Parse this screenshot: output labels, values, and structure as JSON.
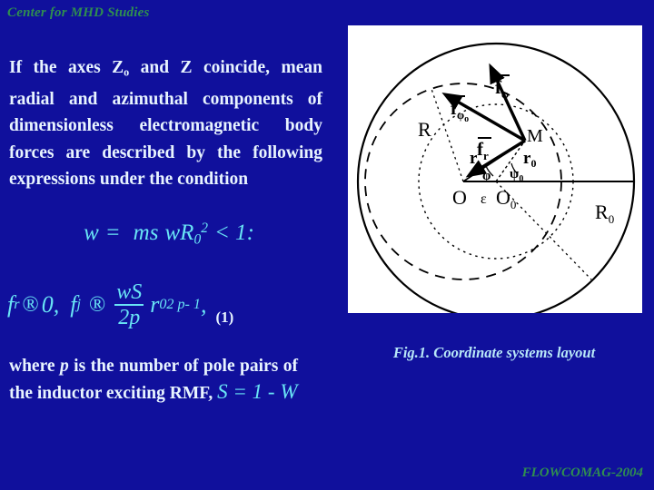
{
  "slide": {
    "background_color": "#10109c",
    "header_color": "#2f8f4f",
    "body_text_color": "#e8f4ff",
    "math_color": "#69e4f5",
    "caption_color": "#b8e8f8"
  },
  "header": {
    "title": "Center for MHD Studies"
  },
  "paragraphs": {
    "intro_part1": "If  the axes Z",
    "intro_sub": "o",
    "intro_part2": "  and Z coincide, mean  radial  and  azimuthal components  of  dimensionless electromagnetic body forces are described   by   the   following expressions under the condition",
    "closing_part1": "where ",
    "closing_italic": "p",
    "closing_part2": " is the number of pole pairs of the inductor exciting RMF, "
  },
  "equations": {
    "condition": {
      "lhs": "w",
      "eq": "=",
      "eta": "m",
      "s": "s",
      "w": "w",
      "R": "R",
      "R_sub": "0",
      "R_sup": "2",
      "rel": "< 1",
      "colon": ":"
    },
    "main": {
      "f_r": "f",
      "f_r_sub": "r",
      "arrow1": "®",
      "zero": "0,",
      "f_j": "f",
      "f_j_sub": "j",
      "arrow2": "®",
      "numerator": "wS",
      "denominator": "2p",
      "r0": "r",
      "r0_sub": "0",
      "r0_sup": "2 p- 1",
      "comma": ",",
      "number": "(1)"
    },
    "slip": {
      "S": "S",
      "eq": "=",
      "one": "1",
      "minus": "-",
      "omega": "W"
    }
  },
  "figure": {
    "caption": "Fig.1. Coordinate systems layout",
    "labels": {
      "R": "R",
      "R0": "R",
      "R0_sub": "0",
      "M": "M",
      "f_phi": "f",
      "f_phi_sub": "φ",
      "f_phi0": "f",
      "f_phi0_sub": "φ",
      "f_phi0_subsub": "o",
      "f_r": "f",
      "f_r_sub": "r",
      "r": "r",
      "r0": "r",
      "r0_sub": "0",
      "phi": "φ",
      "psi0": "ψ",
      "psi0_sub": "0",
      "O": "O",
      "O0": "O",
      "O0_sub": "0",
      "epsilon": "ε"
    }
  },
  "footer": {
    "text": "FLOWCOMAG-2004"
  }
}
